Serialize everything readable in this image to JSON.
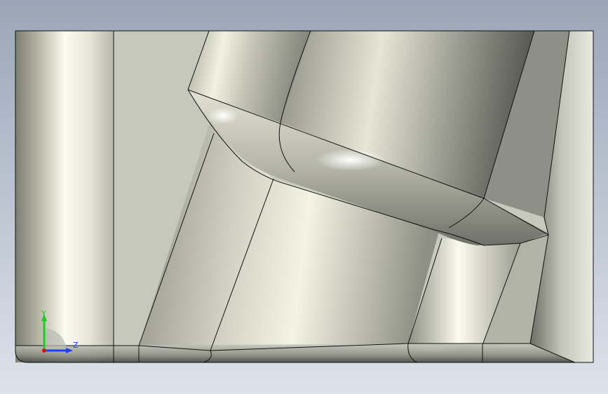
{
  "viewport": {
    "background_top": "#9aa6b7",
    "background_bottom": "#dde2ea",
    "part_base_color": "#c9cabe",
    "edge_color": "#111111"
  },
  "triad": {
    "x_label": "",
    "y_label": "Y",
    "z_label": "Z",
    "y_color": "#1fcc1f",
    "z_color": "#2040ff",
    "origin_color": "#e01010"
  }
}
